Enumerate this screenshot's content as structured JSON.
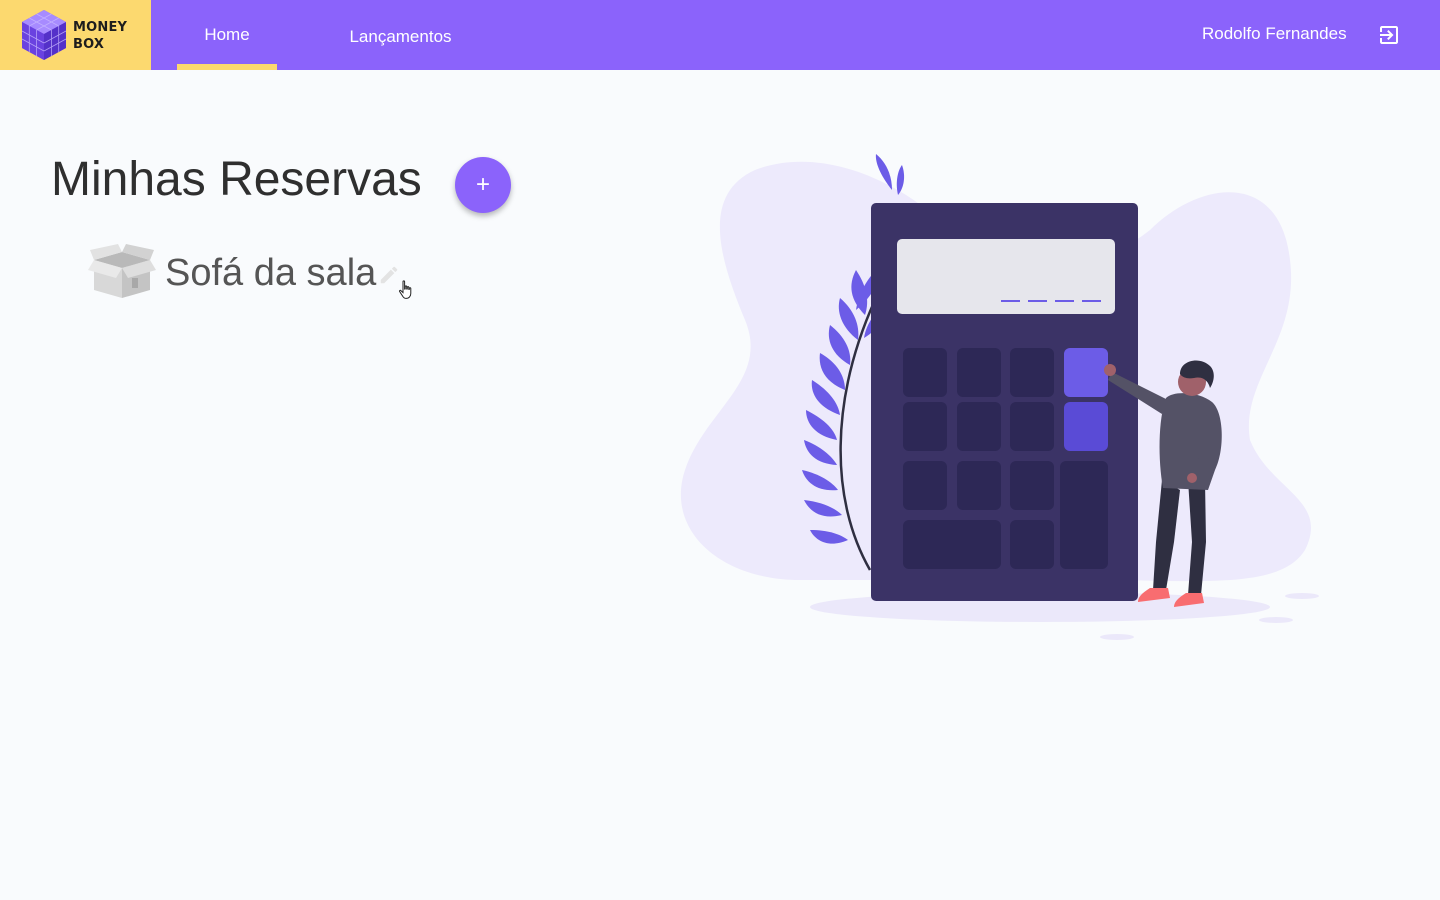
{
  "brand": {
    "line1": "MONEY",
    "line2": "BOX"
  },
  "nav": {
    "home": "Home",
    "lancamentos": "Lançamentos"
  },
  "user": {
    "name": "Rodolfo Fernandes"
  },
  "main": {
    "title": "Minhas Reservas",
    "add_button": "+",
    "reserves": [
      {
        "name": "Sofá da sala"
      }
    ]
  },
  "colors": {
    "primary": "#8b63fb",
    "accent": "#fcd96f",
    "background": "#f9fbfd",
    "calculator": "#3b3366"
  },
  "icons": {
    "logo": "cube-logo-icon",
    "logout": "logout-icon",
    "reserve": "open-box-icon",
    "edit": "pencil-icon"
  }
}
